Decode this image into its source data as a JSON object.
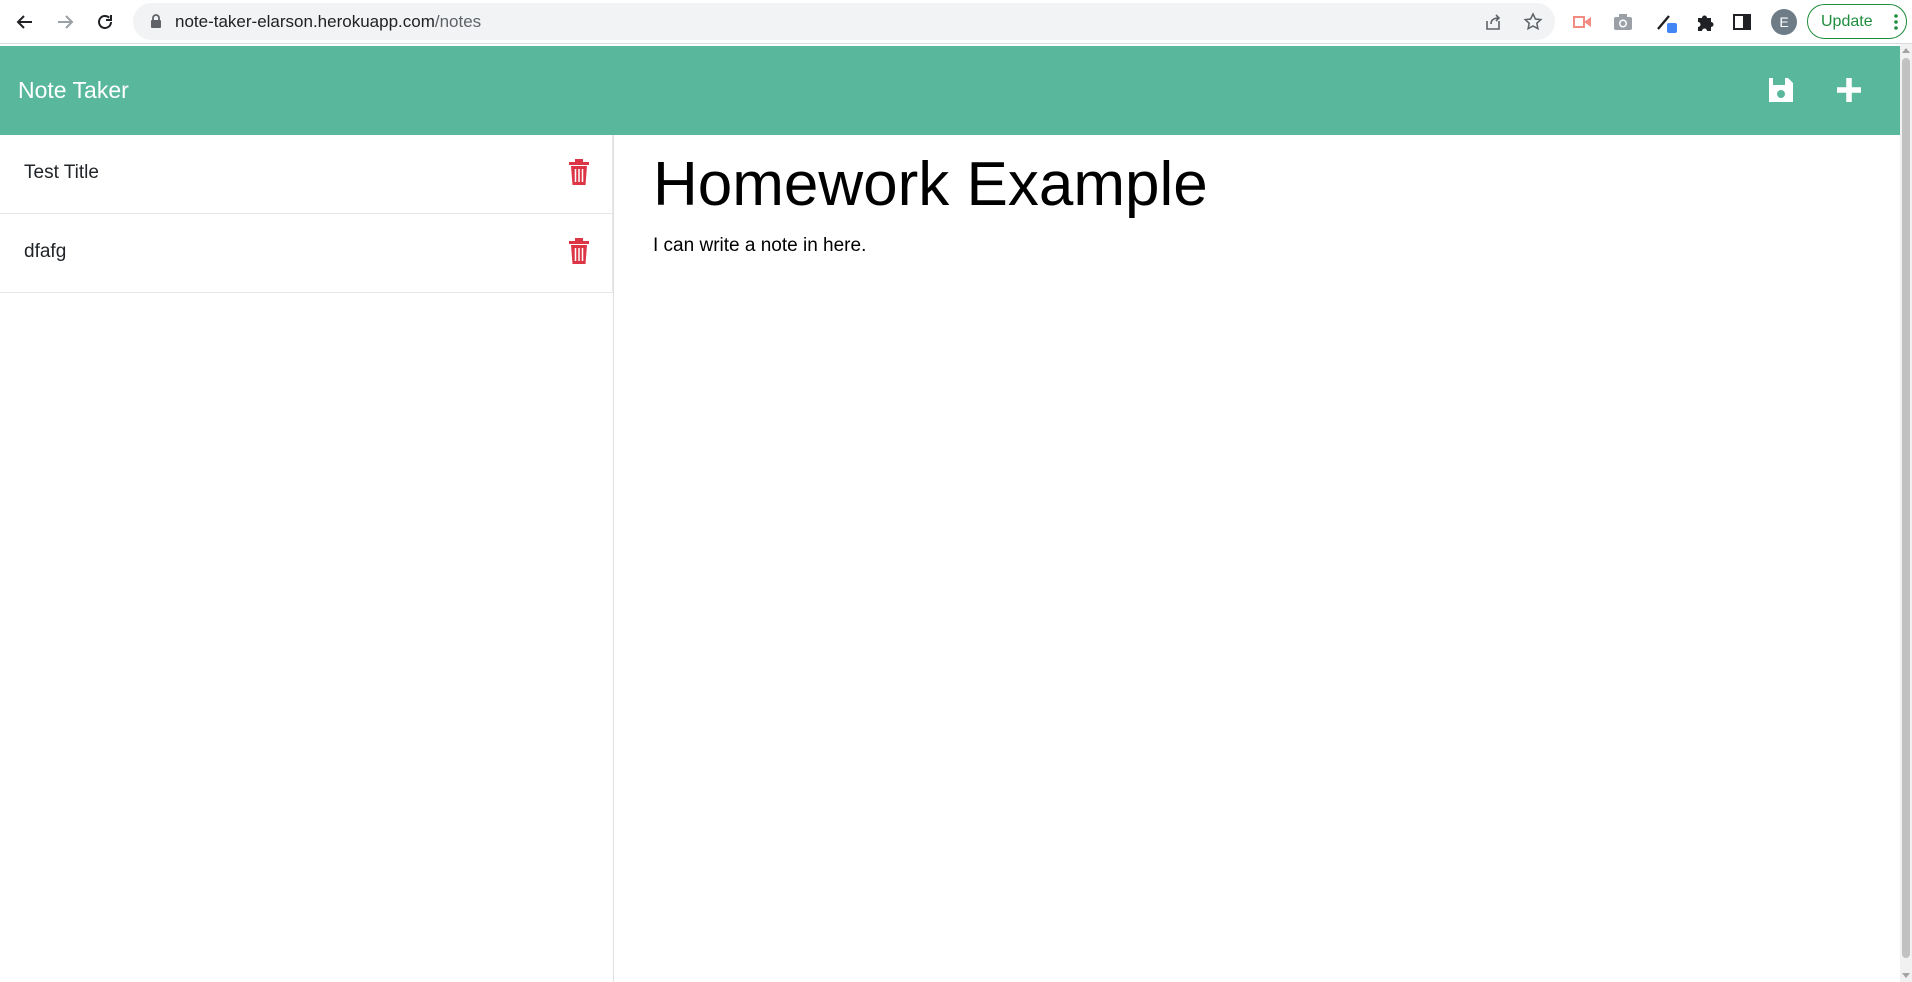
{
  "browser": {
    "url_host": "note-taker-elarson.herokuapp.com",
    "url_path": "/notes",
    "profile_initial": "E",
    "update_label": "Update",
    "icons": [
      "back-icon",
      "forward-icon",
      "reload-icon",
      "lock-icon",
      "share-icon",
      "bookmark-star-icon",
      "screencast-icon",
      "camera-icon",
      "color-picker-icon",
      "extensions-puzzle-icon",
      "side-panel-icon",
      "kebab-menu-icon"
    ]
  },
  "header": {
    "brand": "Note Taker",
    "save_icon": "floppy-disk-icon",
    "new_icon": "plus-icon"
  },
  "notes": [
    {
      "title": "Test Title"
    },
    {
      "title": "dfafg"
    }
  ],
  "editor": {
    "title": "Homework Example",
    "text": "I can write a note in here."
  },
  "colors": {
    "header_bg": "#59b89c",
    "delete_icon": "#dc3545",
    "update_accent": "#1e8e3e"
  }
}
